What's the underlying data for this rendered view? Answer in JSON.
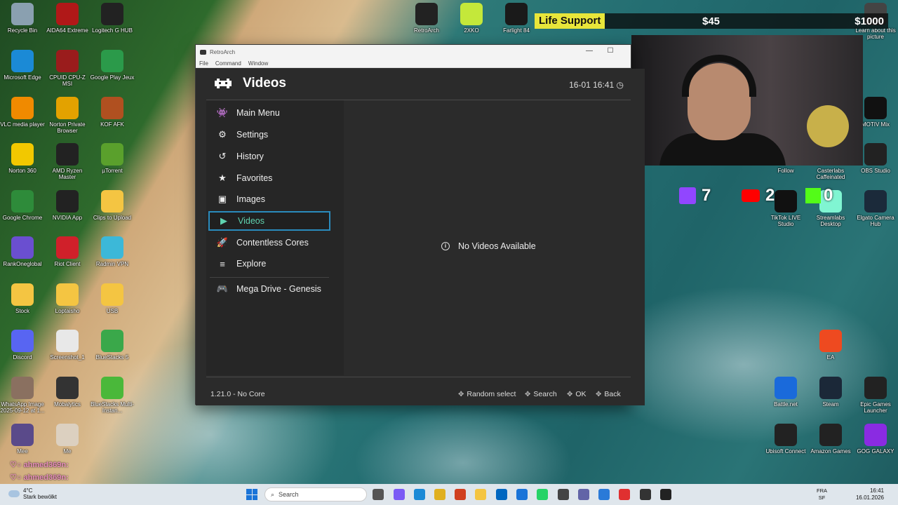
{
  "desktop_icons_left": [
    {
      "label": "Recycle Bin",
      "name": "recycle-bin-icon",
      "color": "#8aa0b0"
    },
    {
      "label": "AIDA64 Extreme",
      "name": "aida64-icon",
      "color": "#b01818"
    },
    {
      "label": "Logitech G HUB",
      "name": "logitech-icon",
      "color": "#222"
    },
    {
      "label": "Microsoft Edge",
      "name": "edge-icon",
      "color": "#1b8ad6"
    },
    {
      "label": "CPUID CPU-Z MSI",
      "name": "cpuz-icon",
      "color": "#9a1c1c"
    },
    {
      "label": "Google Play Jeux",
      "name": "google-play-icon",
      "color": "#2b9a4a"
    },
    {
      "label": "VLC media player",
      "name": "vlc-icon",
      "color": "#f08a00"
    },
    {
      "label": "Norton Private Browser",
      "name": "norton-browser-icon",
      "color": "#e3a200"
    },
    {
      "label": "KOF AFK",
      "name": "kof-icon",
      "color": "#b05020"
    },
    {
      "label": "Norton 360",
      "name": "norton-icon",
      "color": "#f2c800"
    },
    {
      "label": "AMD Ryzen Master",
      "name": "ryzen-icon",
      "color": "#222"
    },
    {
      "label": "µTorrent",
      "name": "utorrent-icon",
      "color": "#5aa02c"
    },
    {
      "label": "Google Chrome",
      "name": "chrome-icon",
      "color": "#2e8b3a"
    },
    {
      "label": "NVIDIA App",
      "name": "nvidia-icon",
      "color": "#222"
    },
    {
      "label": "Clips to Upload",
      "name": "folder-icon",
      "color": "#f4c542"
    },
    {
      "label": "RankOneglobal",
      "name": "rankone-icon",
      "color": "#6a4fd0"
    },
    {
      "label": "Riot Client",
      "name": "riot-icon",
      "color": "#d0202a"
    },
    {
      "label": "Radmin VPN",
      "name": "radmin-icon",
      "color": "#3cb8d8"
    },
    {
      "label": "Stock",
      "name": "folder-icon",
      "color": "#f4c542"
    },
    {
      "label": "Loptaisho",
      "name": "folder-icon",
      "color": "#f4c542"
    },
    {
      "label": "USB",
      "name": "folder-icon",
      "color": "#f4c542"
    },
    {
      "label": "Discord",
      "name": "discord-icon",
      "color": "#5865f2"
    },
    {
      "label": "Screenshot_1",
      "name": "image-file-icon",
      "color": "#e8e8e8"
    },
    {
      "label": "BlueStacks 5",
      "name": "bluestacks-icon",
      "color": "#3aa84a"
    },
    {
      "label": "WhatsApp Image 2025-09-12 at 1...",
      "name": "image-file-icon",
      "color": "#8a7060"
    },
    {
      "label": "Mobalytics",
      "name": "mobalytics-icon",
      "color": "#333"
    },
    {
      "label": "BlueStacks Multi-Instan...",
      "name": "bluestacks-icon",
      "color": "#4ab83a"
    },
    {
      "label": "Mee",
      "name": "image-file-icon",
      "color": "#5a4a8a"
    },
    {
      "label": "Me",
      "name": "image-file-icon",
      "color": "#dcd0c0"
    }
  ],
  "desktop_icons_top": [
    {
      "label": "RetroArch",
      "name": "retroarch-icon",
      "color": "#222"
    },
    {
      "label": "2XKO",
      "name": "2xko-icon",
      "color": "#c4e83a"
    },
    {
      "label": "Farlight 84",
      "name": "farlight-icon",
      "color": "#1a1a1a"
    }
  ],
  "desktop_icons_right": [
    {
      "label": "Learn about this picture",
      "name": "info-icon",
      "color": "#444"
    },
    {
      "label": "MOTIV Mix",
      "name": "motiv-icon",
      "color": "#111"
    },
    {
      "label": "Follow",
      "name": "follow-icon",
      "color": "#333"
    },
    {
      "label": "Casterlabs Caffeinated",
      "name": "casterlabs-icon",
      "color": "#555"
    },
    {
      "label": "OBS Studio",
      "name": "obs-icon",
      "color": "#222"
    },
    {
      "label": "TikTok LIVE Studio",
      "name": "tiktok-icon",
      "color": "#111"
    },
    {
      "label": "Streamlabs Desktop",
      "name": "streamlabs-icon",
      "color": "#80f5d2"
    },
    {
      "label": "Elgato Camera Hub",
      "name": "elgato-icon",
      "color": "#1b2a3a"
    },
    {
      "label": "EA",
      "name": "ea-icon",
      "color": "#ee4a20"
    },
    {
      "label": "Battle.net",
      "name": "battlenet-icon",
      "color": "#1a6adb"
    },
    {
      "label": "Steam",
      "name": "steam-icon",
      "color": "#1b2838"
    },
    {
      "label": "Epic Games Launcher",
      "name": "epic-icon",
      "color": "#222"
    },
    {
      "label": "Ubisoft Connect",
      "name": "ubisoft-icon",
      "color": "#222"
    },
    {
      "label": "Amazon Games",
      "name": "amazon-games-icon",
      "color": "#222"
    },
    {
      "label": "GOG GALAXY",
      "name": "gog-icon",
      "color": "#8a2be2"
    }
  ],
  "overlay": {
    "life_support": "Life Support",
    "amount_current": "$45",
    "amount_goal": "$1000",
    "twitch_count": "7",
    "youtube_count": "2",
    "kick_count": "0"
  },
  "chat": [
    "ahmed369n:",
    "ahmed369n:"
  ],
  "window": {
    "title": "RetroArch",
    "menu": [
      "File",
      "Command",
      "Window"
    ],
    "header_title": "Videos",
    "clock": "16-01 16:41",
    "sidebar": [
      {
        "label": "Main Menu",
        "icon": "👾",
        "name": "sidebar-item-main-menu"
      },
      {
        "label": "Settings",
        "icon": "⚙",
        "name": "sidebar-item-settings"
      },
      {
        "label": "History",
        "icon": "↺",
        "name": "sidebar-item-history"
      },
      {
        "label": "Favorites",
        "icon": "★",
        "name": "sidebar-item-favorites"
      },
      {
        "label": "Images",
        "icon": "▣",
        "name": "sidebar-item-images"
      },
      {
        "label": "Videos",
        "icon": "▶",
        "name": "sidebar-item-videos",
        "selected": true
      },
      {
        "label": "Contentless Cores",
        "icon": "🚀",
        "name": "sidebar-item-contentless-cores"
      },
      {
        "label": "Explore",
        "icon": "≡",
        "name": "sidebar-item-explore"
      },
      {
        "label": "Mega Drive - Genesis",
        "icon": "🎮",
        "name": "sidebar-item-mega-drive"
      }
    ],
    "empty_message": "No Videos Available",
    "version": "1.21.0 - No Core",
    "footer_buttons": [
      "Random select",
      "Search",
      "OK",
      "Back"
    ]
  },
  "taskbar": {
    "temperature": "4°C",
    "weather": "Stark bewölkt",
    "search_placeholder": "Search",
    "lang": "FRA",
    "lang2": "SF",
    "time": "16:41",
    "date": "16.01.2026"
  }
}
